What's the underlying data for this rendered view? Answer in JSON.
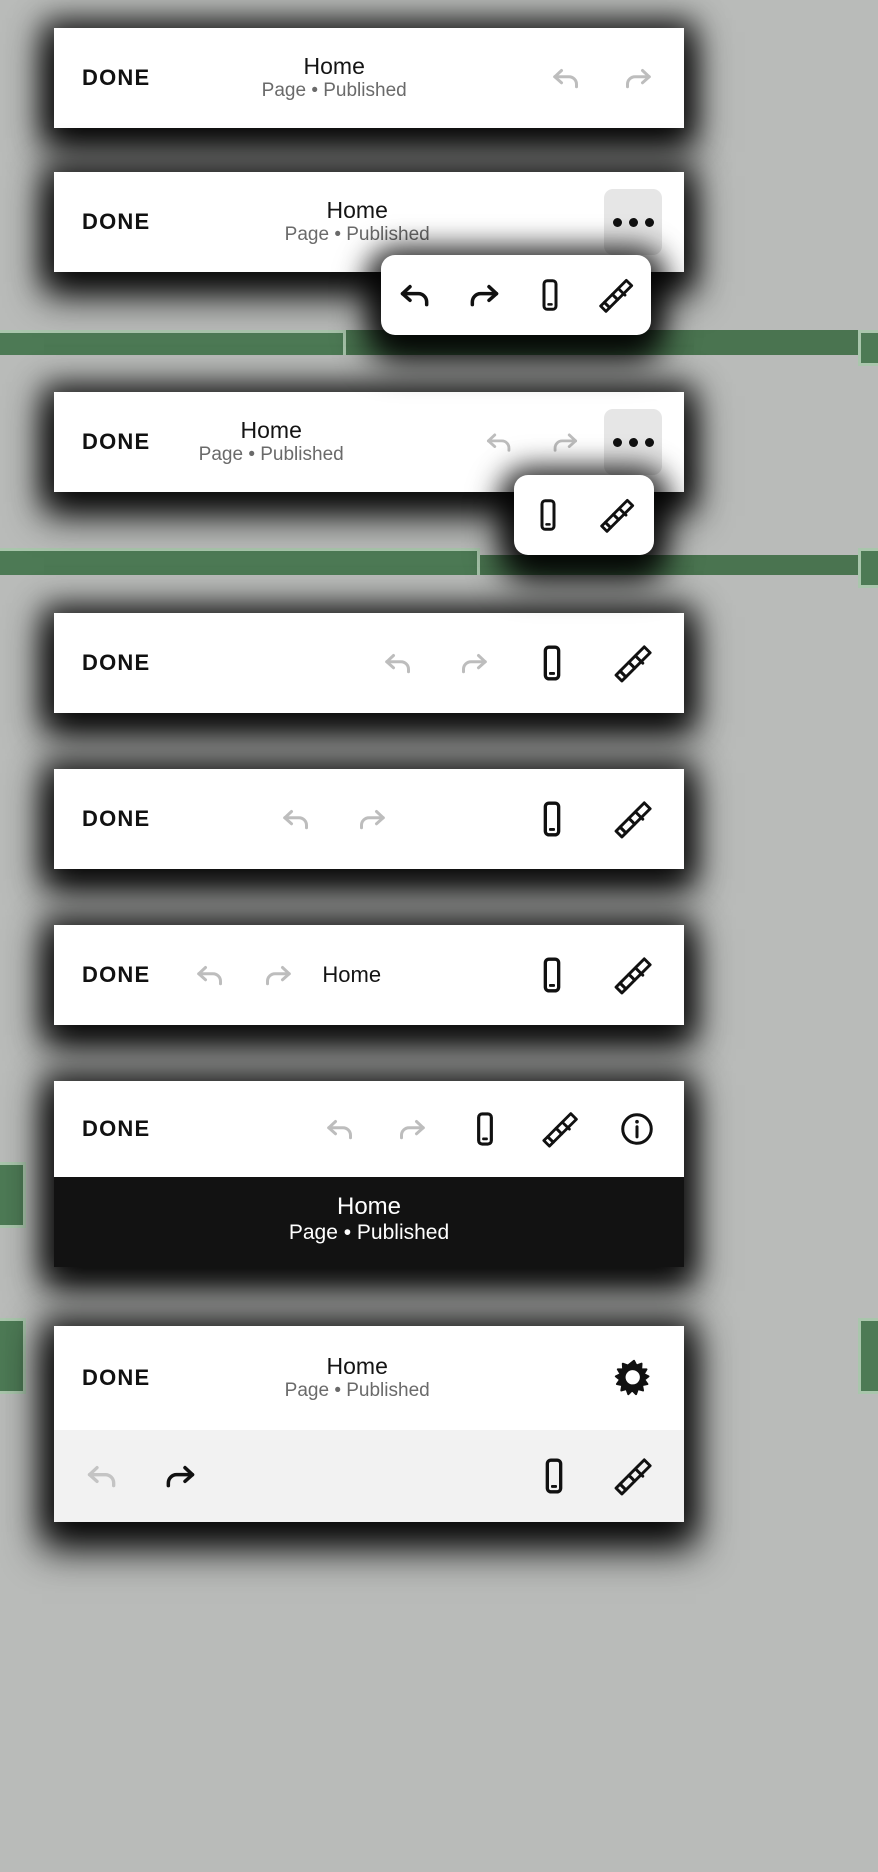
{
  "theme": {
    "background_green": "#4a7450",
    "plate_gray": "#b9bbb9",
    "bar_white": "#ffffff",
    "dark_strip": "#121212",
    "grey_strip": "#f2f2f2",
    "menu_button_bg": "#e6e6e6",
    "icon_active": "#111111",
    "icon_disabled": "#bdbdbd",
    "subtitle_gray": "#6a6a6a"
  },
  "labels": {
    "done": "DONE",
    "title": "Home",
    "subtitle": "Page • Published"
  },
  "icon_names": {
    "undo": "undo-icon",
    "redo": "redo-icon",
    "mobile": "mobile-preview-icon",
    "brush": "paintbrush-icon",
    "info": "info-icon",
    "gear": "gear-icon",
    "more": "more-options-icon"
  },
  "variants": [
    {
      "id": "variant-1",
      "name": "title-center-undo-redo",
      "done": "DONE",
      "title": "Home",
      "subtitle": "Page • Published",
      "icons": [
        "undo",
        "redo"
      ],
      "icon_states": [
        "disabled",
        "disabled"
      ]
    },
    {
      "id": "variant-2",
      "name": "title-center-overflow-open",
      "done": "DONE",
      "title": "Home",
      "subtitle": "Page • Published",
      "icons": [
        "more"
      ],
      "popup_icons": [
        "undo",
        "redo",
        "mobile",
        "brush"
      ],
      "popup_icon_states": [
        "active",
        "active",
        "active",
        "active"
      ]
    },
    {
      "id": "variant-3",
      "name": "title-center-undo-redo-overflow-open",
      "done": "DONE",
      "title": "Home",
      "subtitle": "Page • Published",
      "icons": [
        "undo",
        "redo",
        "more"
      ],
      "icon_states": [
        "disabled",
        "disabled",
        "active"
      ],
      "popup_icons": [
        "mobile",
        "brush"
      ],
      "popup_icon_states": [
        "active",
        "active"
      ]
    },
    {
      "id": "variant-4",
      "name": "no-title-four-icons-right",
      "done": "DONE",
      "icons": [
        "undo",
        "redo",
        "mobile",
        "brush"
      ],
      "icon_states": [
        "disabled",
        "disabled",
        "active",
        "active"
      ]
    },
    {
      "id": "variant-5",
      "name": "no-title-undo-redo-center",
      "done": "DONE",
      "icons": [
        "undo",
        "redo",
        "mobile",
        "brush"
      ],
      "icon_states": [
        "disabled",
        "disabled",
        "active",
        "active"
      ]
    },
    {
      "id": "variant-6",
      "name": "inline-title-after-redo",
      "done": "DONE",
      "title": "Home",
      "icons": [
        "undo",
        "redo",
        "mobile",
        "brush"
      ],
      "icon_states": [
        "disabled",
        "disabled",
        "active",
        "active"
      ]
    },
    {
      "id": "variant-7",
      "name": "five-icons-with-dark-title-strip",
      "done": "DONE",
      "title": "Home",
      "subtitle": "Page • Published",
      "icons": [
        "undo",
        "redo",
        "mobile",
        "brush",
        "info"
      ],
      "icon_states": [
        "disabled",
        "disabled",
        "active",
        "active",
        "active"
      ]
    },
    {
      "id": "variant-8",
      "name": "title-center-gear-with-secondary-toolbar",
      "done": "DONE",
      "title": "Home",
      "subtitle": "Page • Published",
      "icons": [
        "gear"
      ],
      "icon_states": [
        "active"
      ],
      "secondary_icons": [
        "undo",
        "redo",
        "mobile",
        "brush"
      ],
      "secondary_icon_states": [
        "disabled",
        "active",
        "active",
        "active"
      ]
    }
  ]
}
